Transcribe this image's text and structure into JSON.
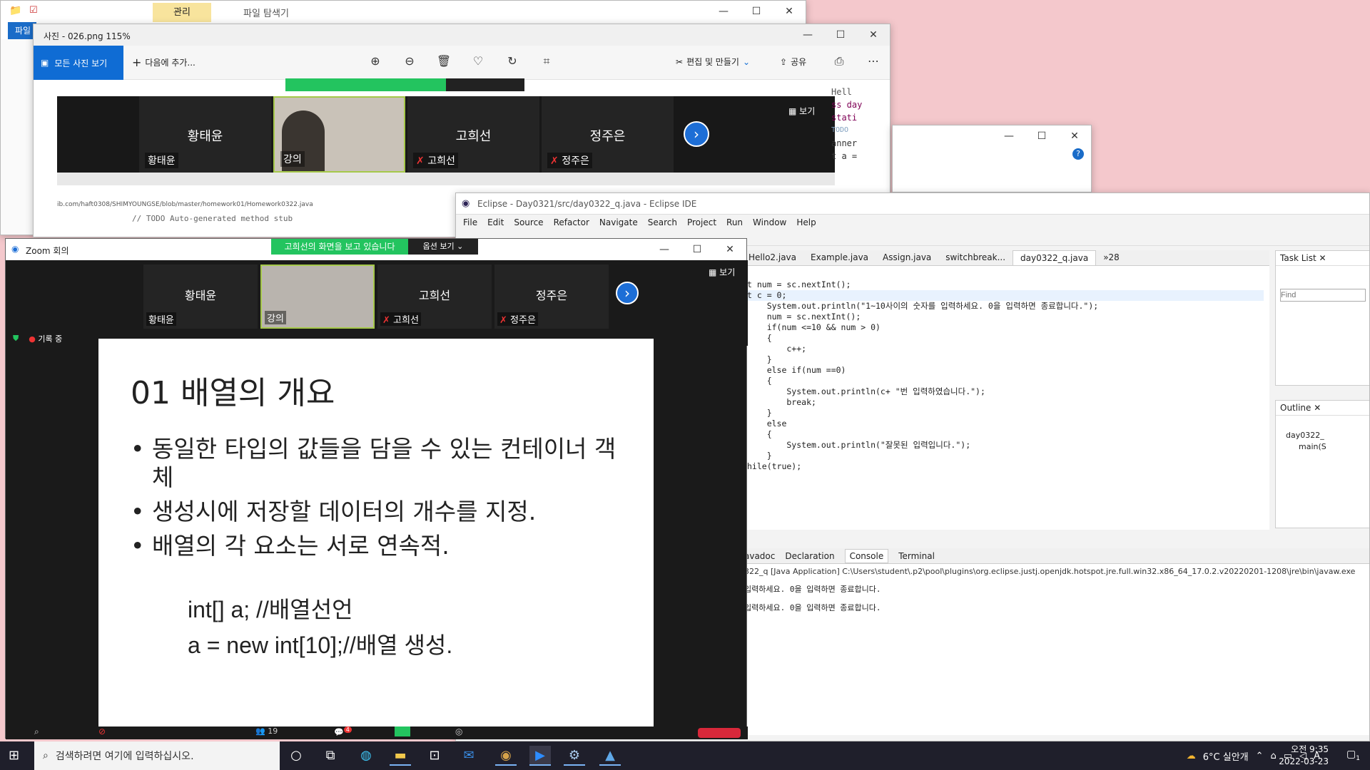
{
  "explorer": {
    "ribbon_tab": "관리",
    "title": "파일 탐색기",
    "file_tab": "파일"
  },
  "photos": {
    "title": "사진 - 026.png   115%",
    "all_photos": "모든 사진 보기",
    "add_to": "다음에 추가...",
    "edit_create": "편집 및 만들기",
    "share": "공유",
    "image": {
      "view_label": "보기",
      "tiles": [
        {
          "big": "황태윤",
          "small": "황태윤"
        },
        {
          "big": "",
          "small": "강의"
        },
        {
          "big": "고희선",
          "small": "고희선"
        },
        {
          "big": "정주은",
          "small": "정주은"
        }
      ]
    }
  },
  "browser_fragment": {
    "url": "ib.com/haft0308/SHIMYOUNGSE/blob/master/homework01/Homework0322.java",
    "comment": "// TODO Auto-generated method stub",
    "side_hello": "Hell",
    "side_code": [
      "ss day",
      "stati",
      "TODO",
      "anner",
      "t a ="
    ]
  },
  "eclipse": {
    "title": "Eclipse - Day0321/src/day0322_q.java - Eclipse IDE",
    "menu": [
      "File",
      "Edit",
      "Source",
      "Refactor",
      "Navigate",
      "Search",
      "Project",
      "Run",
      "Window",
      "Help"
    ],
    "tabs": [
      "Hello2.java",
      "Example.java",
      "Assign.java",
      "switchbreak...",
      "day0322_q.java",
      "»28"
    ],
    "code_lines": [
      "t num = sc.nextInt();",
      "t c = 0;",
      "",
      "",
      "    System.out.println(\"1~10사이의 숫자를 입력하세요. 0을 입력하면 종료합니다.\");",
      "    num = sc.nextInt();",
      "    if(num <=10 && num > 0)",
      "    {",
      "        c++;",
      "    }",
      "    else if(num ==0)",
      "    {",
      "        System.out.println(c+ \"번 입력하였습니다.\");",
      "        break;",
      "    }",
      "    else",
      "    {",
      "        System.out.println(\"잘못된 입력입니다.\");",
      "    }",
      "hile(true);"
    ],
    "task_list": "Task List",
    "find_placeholder": "Find",
    "outline": "Outline",
    "outline_items": [
      "day0322_",
      "main(S"
    ],
    "console_tabs": [
      "avadoc",
      "Declaration",
      "Console",
      "Terminal"
    ],
    "console_path": "322_q [Java Application] C:\\Users\\student\\.p2\\pool\\plugins\\org.eclipse.justj.openjdk.hotspot.jre.full.win32.x86_64_17.0.2.v20220201-1208\\jre\\bin\\javaw.exe",
    "console_lines": [
      "입력하세요. 0을 입력하면 종료합니다.",
      "입력하세요. 0을 입력하면 종료합니다."
    ]
  },
  "zoom": {
    "title": "Zoom 회의",
    "banner": "고희선의 화면을 보고 있습니다",
    "options": "옵션 보기",
    "view_label": "보기",
    "recording": "기록 중",
    "tiles": [
      {
        "big": "황태윤",
        "small": "황태윤"
      },
      {
        "big": "",
        "small": "강의"
      },
      {
        "big": "고희선",
        "small": "고희선"
      },
      {
        "big": "정주은",
        "small": "정주은"
      }
    ],
    "participants": "19",
    "chat_badge": "4",
    "slide": {
      "title": "01 배열의 개요",
      "bullets": [
        "동일한 타입의 값들을 담을 수  있는 컨테이너 객체",
        "생성시에 저장할 데이터의 개수를 지정.",
        "배열의 각 요소는 서로 연속적."
      ],
      "code1": "int[] a; //배열선언",
      "code2": "a = new int[10];//배열 생성."
    }
  },
  "taskbar": {
    "search_placeholder": "검색하려면 여기에 입력하십시오.",
    "weather": "6°C  실안개",
    "time": "오전 9:35",
    "date": "2022-03-23",
    "ime": "A",
    "notif": "1"
  }
}
